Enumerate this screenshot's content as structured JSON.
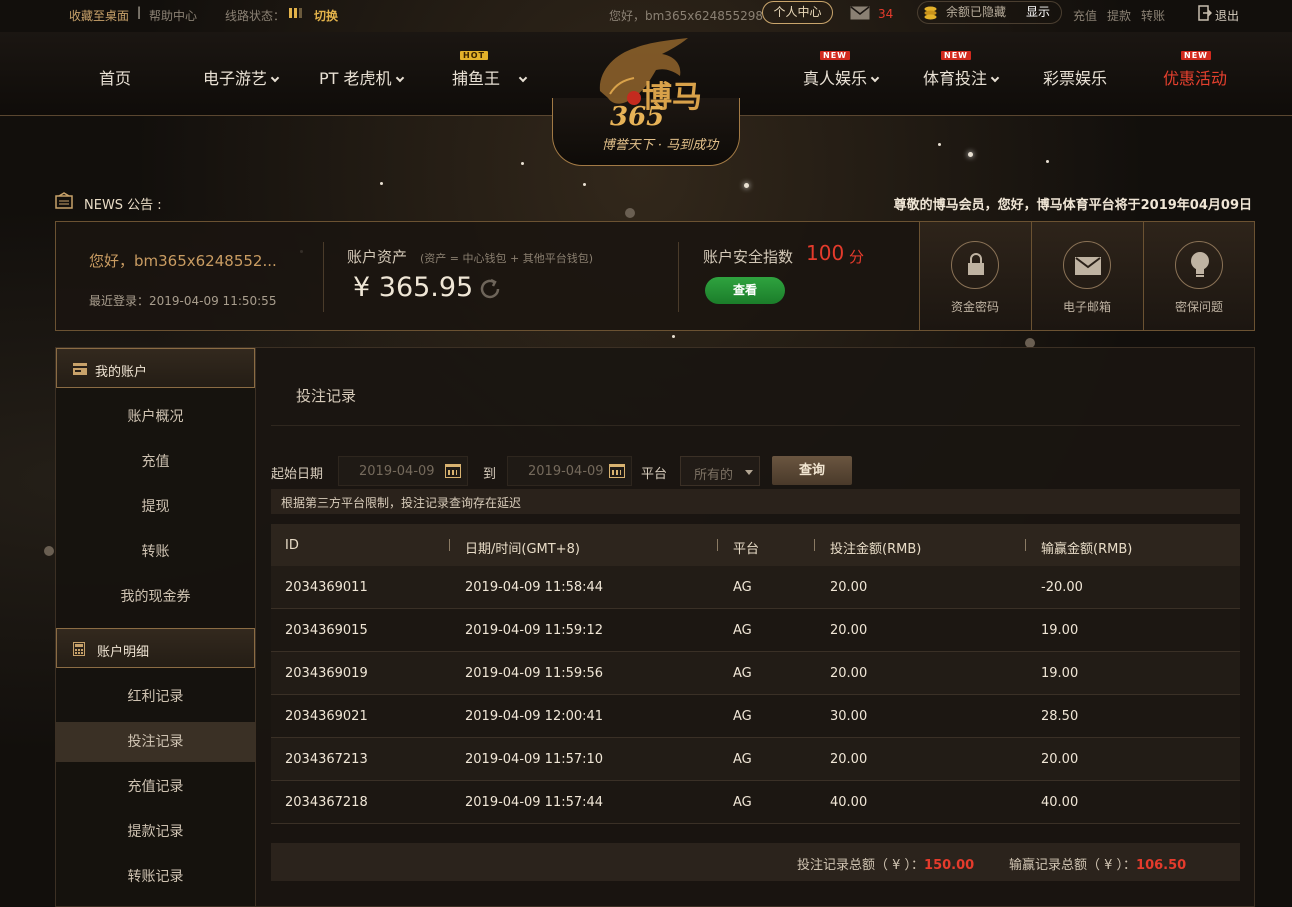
{
  "topbar": {
    "bookmark": "收藏至桌面",
    "help": "帮助中心",
    "line_status": "线路状态：",
    "switch": "切换",
    "greeting": "您好，bm365x624855298",
    "personal_center": "个人中心",
    "mail_count": "34",
    "balance_hidden": "余额已隐藏",
    "show": "显示",
    "deposit": "充值",
    "withdraw": "提款",
    "transfer": "转账",
    "logout": "退出"
  },
  "nav": {
    "home": "首页",
    "egames": "电子游艺",
    "pt_slots": "PT 老虎机",
    "fishing": "捕鱼王",
    "live": "真人娱乐",
    "sports": "体育投注",
    "lottery": "彩票娱乐",
    "promo": "优惠活动",
    "tag_hot": "HOT",
    "tag_new": "NEW"
  },
  "logo": {
    "name_cn": "博马",
    "number": "365",
    "slogan": "博誉天下 · 马到成功"
  },
  "news": {
    "label": "NEWS 公告 :",
    "ticker": "尊敬的博马会员，您好，博马体育平台将于2019年04月09日"
  },
  "account": {
    "hello": "您好，bm365x6248552...",
    "last_login": "最近登录：2019-04-09 11:50:55",
    "assets_label": "账户资产",
    "assets_note": "(资产 = 中心钱包 + 其他平台钱包)",
    "assets_value": "¥ 365.95",
    "security_label": "账户安全指数",
    "security_score": "100",
    "security_unit": "分",
    "view_btn": "查看",
    "security_items": [
      "资金密码",
      "电子邮箱",
      "密保问题"
    ]
  },
  "sidebar": {
    "my_account": "我的账户",
    "account_items": [
      "账户概况",
      "充值",
      "提现",
      "转账",
      "我的现金券"
    ],
    "details": "账户明细",
    "detail_items": [
      "红利记录",
      "投注记录",
      "充值记录",
      "提款记录",
      "转账记录"
    ]
  },
  "main": {
    "title": "投注记录",
    "filter": {
      "start_label": "起始日期",
      "start_date": "2019-04-09",
      "to": "到",
      "end_date": "2019-04-09",
      "platform_label": "平台",
      "platform_value": "所有的",
      "query_btn": "查询"
    },
    "notice": "根据第三方平台限制，投注记录查询存在延迟",
    "table": {
      "headers": [
        "ID",
        "日期/时间(GMT+8)",
        "平台",
        "投注金额(RMB)",
        "输赢金额(RMB)"
      ],
      "rows": [
        [
          "2034369011",
          "2019-04-09 11:58:44",
          "AG",
          "20.00",
          "-20.00"
        ],
        [
          "2034369015",
          "2019-04-09 11:59:12",
          "AG",
          "20.00",
          "19.00"
        ],
        [
          "2034369019",
          "2019-04-09 11:59:56",
          "AG",
          "20.00",
          "19.00"
        ],
        [
          "2034369021",
          "2019-04-09 12:00:41",
          "AG",
          "30.00",
          "28.50"
        ],
        [
          "2034367213",
          "2019-04-09 11:57:10",
          "AG",
          "20.00",
          "20.00"
        ],
        [
          "2034367218",
          "2019-04-09 11:57:44",
          "AG",
          "40.00",
          "40.00"
        ]
      ]
    },
    "totals": {
      "bet_label": "投注记录总额（ ¥ ）：",
      "bet_value": "150.00",
      "win_label": "输赢记录总额（ ¥ ）：",
      "win_value": "106.50"
    }
  },
  "colors": {
    "gold": "#c8a26a",
    "accent_red": "#e53b2c",
    "green": "#2fa33f",
    "bg": "#120f0c"
  }
}
